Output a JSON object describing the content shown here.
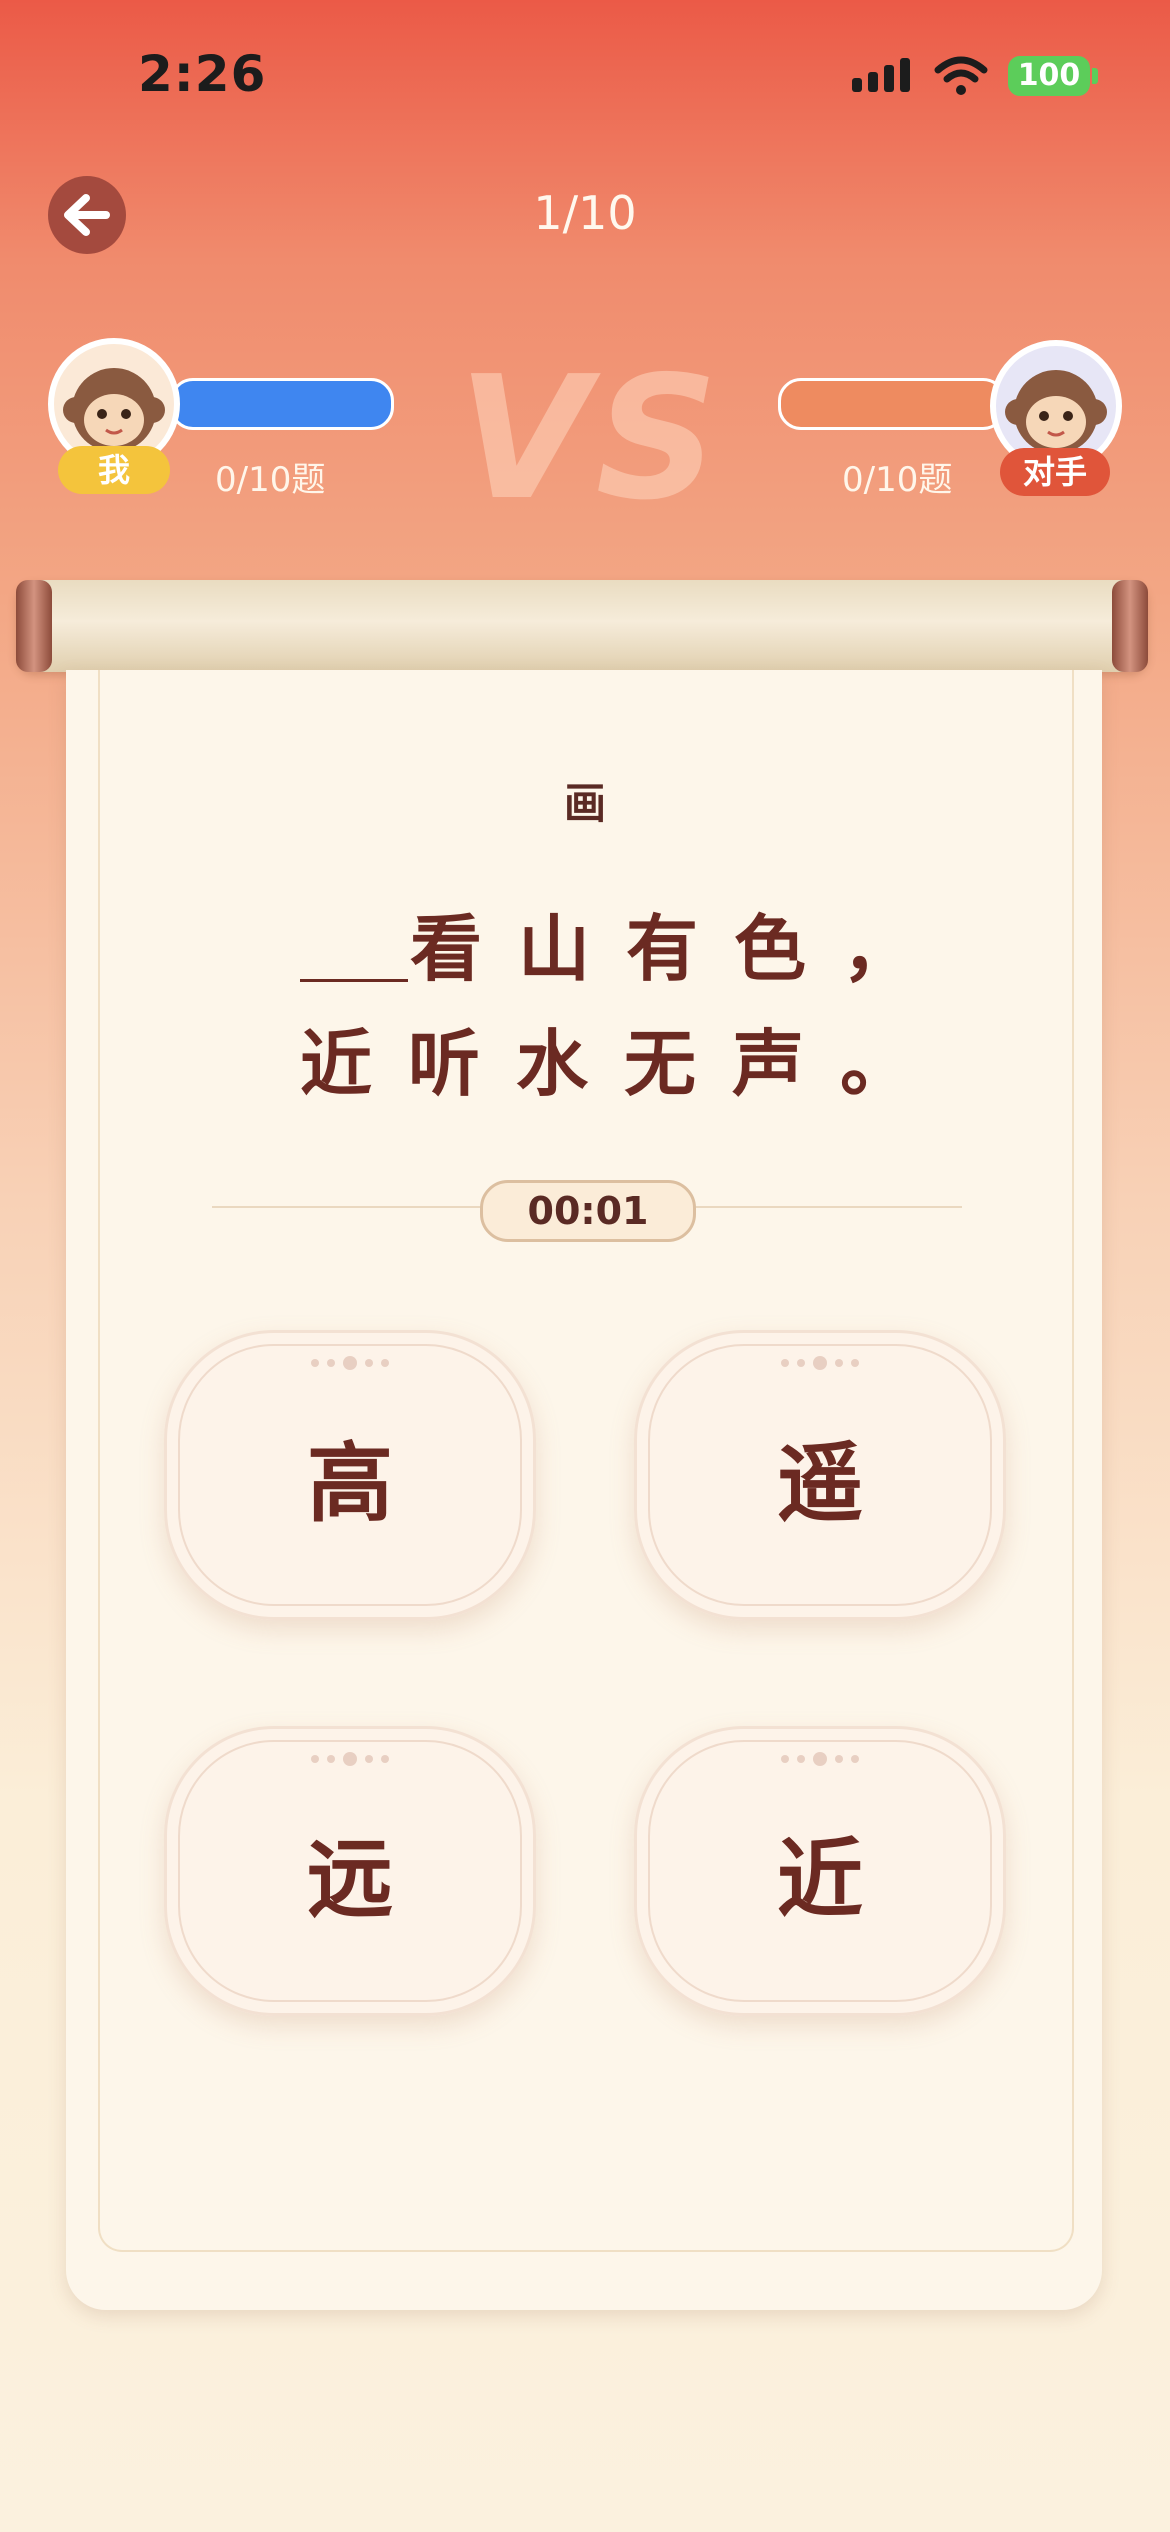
{
  "status": {
    "time": "2:26",
    "battery": "100"
  },
  "header": {
    "progress": "1/10"
  },
  "players": {
    "me": {
      "tag": "我",
      "count": "0/10题"
    },
    "opponent": {
      "tag": "对手",
      "count": "0/10题"
    },
    "vs": "VS"
  },
  "question": {
    "title": "画",
    "line1": "看山有色，",
    "line2": "近听水无声。"
  },
  "timer": "00:01",
  "options": [
    "高",
    "遥",
    "远",
    "近"
  ]
}
